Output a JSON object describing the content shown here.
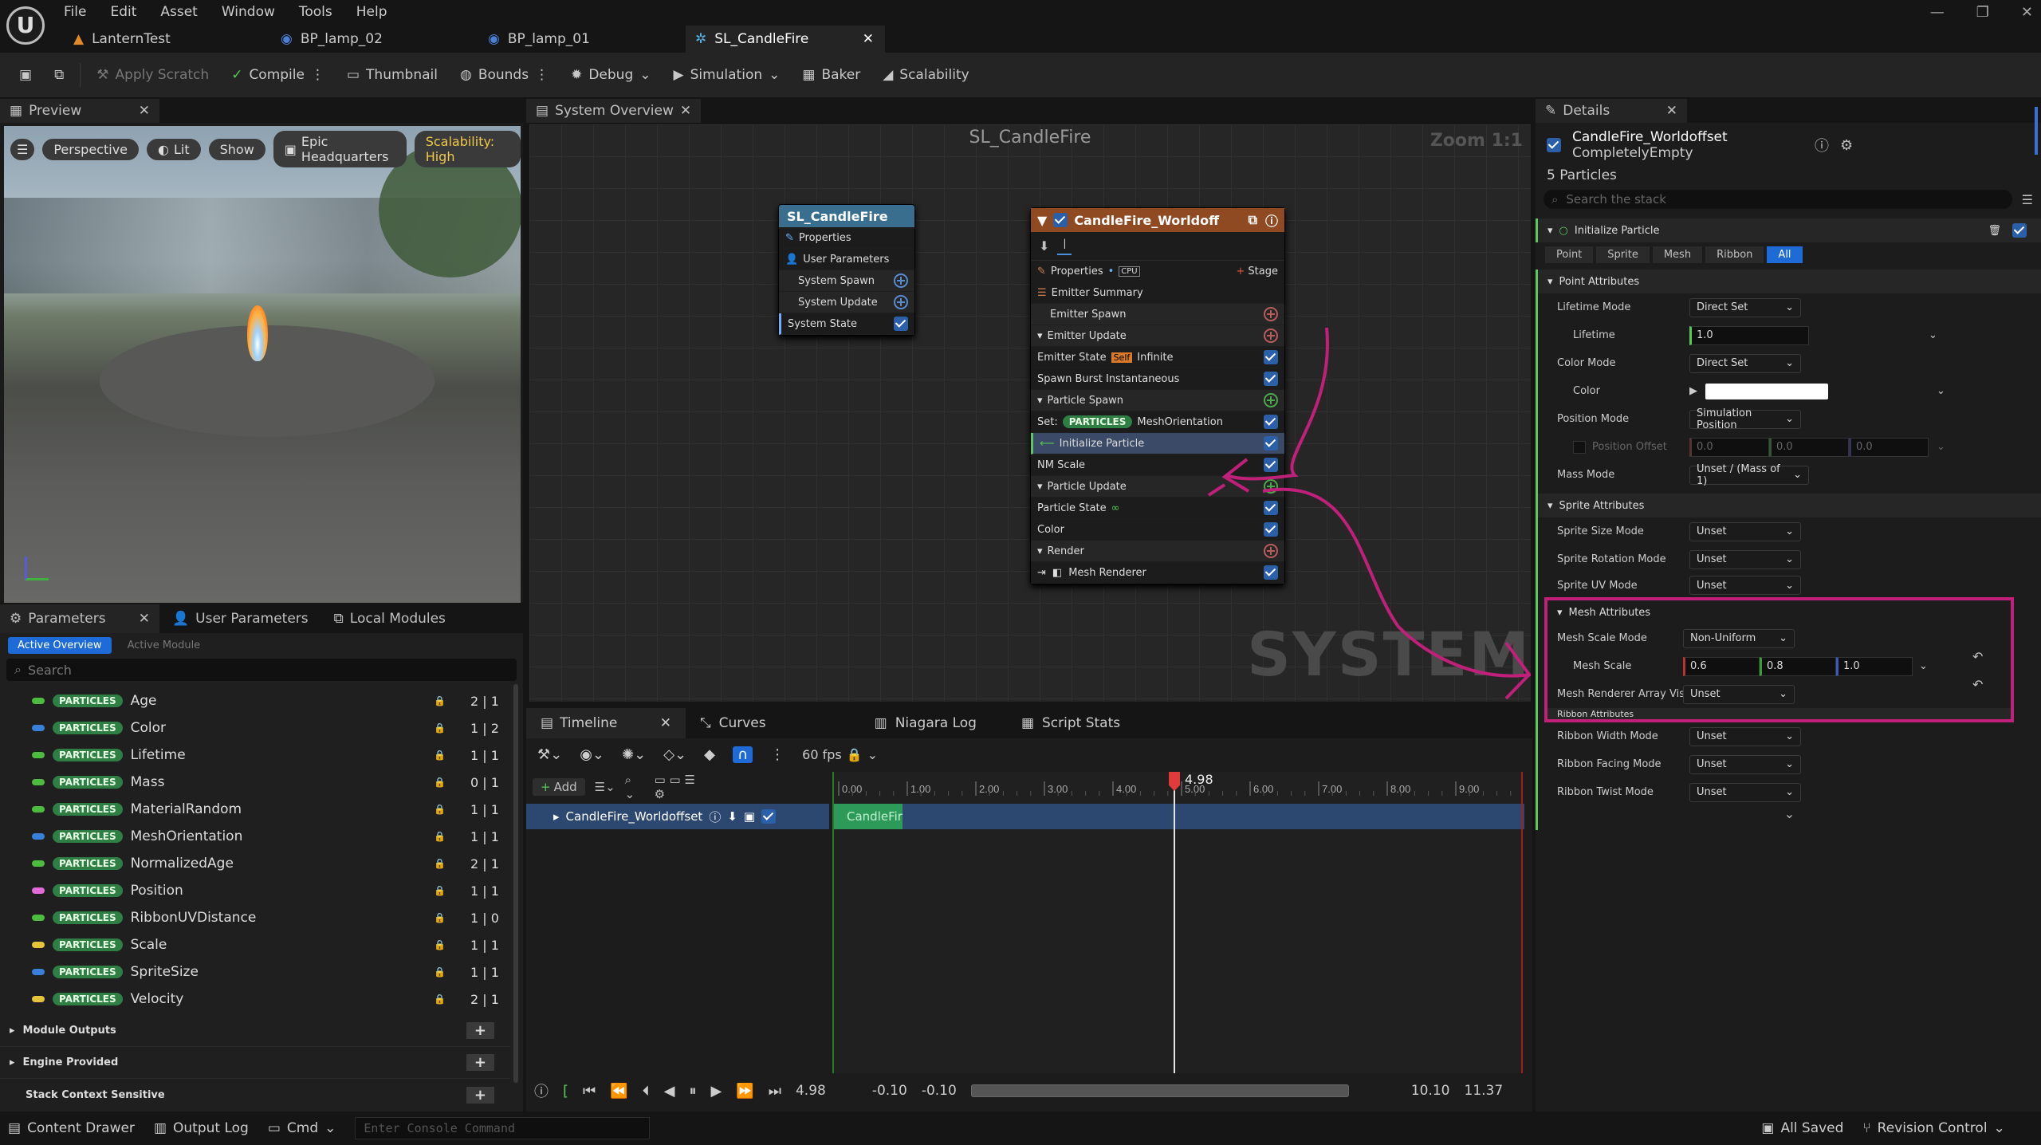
{
  "menubar": {
    "items": [
      "File",
      "Edit",
      "Asset",
      "Window",
      "Tools",
      "Help"
    ],
    "doc_tabs": [
      {
        "label": "LanternTest",
        "active": false
      },
      {
        "label": "BP_lamp_02",
        "active": false
      },
      {
        "label": "BP_lamp_01",
        "active": false
      },
      {
        "label": "SL_CandleFire",
        "active": true
      }
    ]
  },
  "toolbar": {
    "apply_scratch": "Apply Scratch",
    "compile": "Compile",
    "thumbnail": "Thumbnail",
    "bounds": "Bounds",
    "debug": "Debug",
    "simulation": "Simulation",
    "baker": "Baker",
    "scalability": "Scalability"
  },
  "preview": {
    "tab": "Preview",
    "perspective": "Perspective",
    "lit": "Lit",
    "show": "Show",
    "hq": "Epic Headquarters",
    "scalability": "Scalability: High"
  },
  "params": {
    "tabs": [
      "Parameters",
      "User Parameters",
      "Local Modules"
    ],
    "active_overview": "Active Overview",
    "active_module": "Active Module",
    "search_placeholder": "Search",
    "tag": "PARTICLES",
    "items": [
      {
        "name": "Age",
        "count": "2 | 1",
        "color": "#4dbb3f"
      },
      {
        "name": "Color",
        "count": "1 | 2",
        "color": "#3a7fd8"
      },
      {
        "name": "Lifetime",
        "count": "1 | 1",
        "color": "#4dbb3f"
      },
      {
        "name": "Mass",
        "count": "0 | 1",
        "color": "#4dbb3f"
      },
      {
        "name": "MaterialRandom",
        "count": "1 | 1",
        "color": "#4dbb3f"
      },
      {
        "name": "MeshOrientation",
        "count": "1 | 1",
        "color": "#3a7fd8"
      },
      {
        "name": "NormalizedAge",
        "count": "2 | 1",
        "color": "#4dbb3f"
      },
      {
        "name": "Position",
        "count": "1 | 1",
        "color": "#e06bd6"
      },
      {
        "name": "RibbonUVDistance",
        "count": "1 | 0",
        "color": "#4dbb3f"
      },
      {
        "name": "Scale",
        "count": "1 | 1",
        "color": "#e5c33a"
      },
      {
        "name": "SpriteSize",
        "count": "1 | 1",
        "color": "#3a7fd8"
      },
      {
        "name": "Velocity",
        "count": "2 | 1",
        "color": "#e5c33a"
      }
    ],
    "sections": [
      "Module Outputs",
      "Engine Provided",
      "Stack Context Sensitive"
    ]
  },
  "overview": {
    "tab": "System Overview",
    "title": "SL_CandleFire",
    "zoom": "Zoom 1:1",
    "watermark": "SYSTEM",
    "system_node": {
      "title": "SL_CandleFire",
      "rows": [
        "Properties",
        "User Parameters",
        "System Spawn",
        "System Update",
        "System State"
      ]
    },
    "emitter_node": {
      "title": "CandleFire_Worldoff",
      "stage": "Stage",
      "cpu": "CPU",
      "rows": {
        "properties": "Properties",
        "summary": "Emitter Summary",
        "emitter_spawn": "Emitter Spawn",
        "emitter_update": "Emitter Update",
        "emitter_state": "Emitter State",
        "self": "Self",
        "infinite": "Infinite",
        "spawn_burst": "Spawn Burst Instantaneous",
        "particle_spawn": "Particle Spawn",
        "set": "Set:",
        "mesh_orientation": "MeshOrientation",
        "init_particle": "Initialize Particle",
        "nm_scale": "NM Scale",
        "particle_update": "Particle Update",
        "particle_state": "Particle State",
        "color": "Color",
        "render": "Render",
        "mesh_renderer": "Mesh Renderer"
      }
    }
  },
  "timeline": {
    "tabs": [
      "Timeline",
      "Curves",
      "Niagara Log",
      "Script Stats"
    ],
    "add": "Add",
    "fps": "60 fps",
    "track": "CandleFire_Worldoffset",
    "clip": "CandleFir",
    "playhead": "4.98",
    "ticks": [
      "0.00",
      "1.00",
      "2.00",
      "3.00",
      "4.00",
      "5.00",
      "6.00",
      "7.00",
      "8.00",
      "9.00"
    ],
    "start_a": "-0.10",
    "start_b": "-0.10",
    "end_a": "10.10",
    "end_b": "11.37",
    "current": "4.98"
  },
  "details": {
    "tab": "Details",
    "emitter_name": "CandleFire_Worldoffset",
    "emitter_sub": "CompletelyEmpty",
    "particles": "5 Particles",
    "search_placeholder": "Search the stack",
    "module": "Initialize Particle",
    "filters": [
      "Point",
      "Sprite",
      "Mesh",
      "Ribbon",
      "All"
    ],
    "point_attributes": "Point Attributes",
    "lifetime_mode_label": "Lifetime Mode",
    "lifetime_mode": "Direct Set",
    "lifetime_label": "Lifetime",
    "lifetime": "1.0",
    "color_mode_label": "Color Mode",
    "color_mode": "Direct Set",
    "color_label": "Color",
    "position_mode_label": "Position Mode",
    "position_mode": "Simulation Position",
    "position_offset_label": "Position Offset",
    "position_offset": [
      "0.0",
      "0.0",
      "0.0"
    ],
    "mass_mode_label": "Mass Mode",
    "mass_mode": "Unset / (Mass of 1)",
    "sprite_attributes": "Sprite Attributes",
    "sprite_size_label": "Sprite Size Mode",
    "sprite_size": "Unset",
    "sprite_rot_label": "Sprite Rotation Mode",
    "sprite_rot": "Unset",
    "sprite_uv_label": "Sprite UV Mode",
    "sprite_uv": "Unset",
    "mesh_attributes": "Mesh Attributes",
    "mesh_scale_mode_label": "Mesh Scale Mode",
    "mesh_scale_mode": "Non-Uniform",
    "mesh_scale_label": "Mesh Scale",
    "mesh_scale": [
      "0.6",
      "0.8",
      "1.0"
    ],
    "mesh_renderer_label": "Mesh Renderer Array Vis",
    "mesh_renderer": "Unset",
    "ribbon_attributes": "Ribbon Attributes",
    "ribbon_width_label": "Ribbon Width Mode",
    "ribbon_width": "Unset",
    "ribbon_facing_label": "Ribbon Facing Mode",
    "ribbon_facing": "Unset",
    "ribbon_twist_label": "Ribbon Twist Mode",
    "ribbon_twist": "Unset"
  },
  "statusbar": {
    "content_drawer": "Content Drawer",
    "output_log": "Output Log",
    "cmd": "Cmd",
    "console_placeholder": "Enter Console Command",
    "all_saved": "All Saved",
    "revision": "Revision Control"
  },
  "colors": {
    "accent": "#2b5fa8",
    "annotation": "#c0207a",
    "playhead": "#e23a3a"
  }
}
